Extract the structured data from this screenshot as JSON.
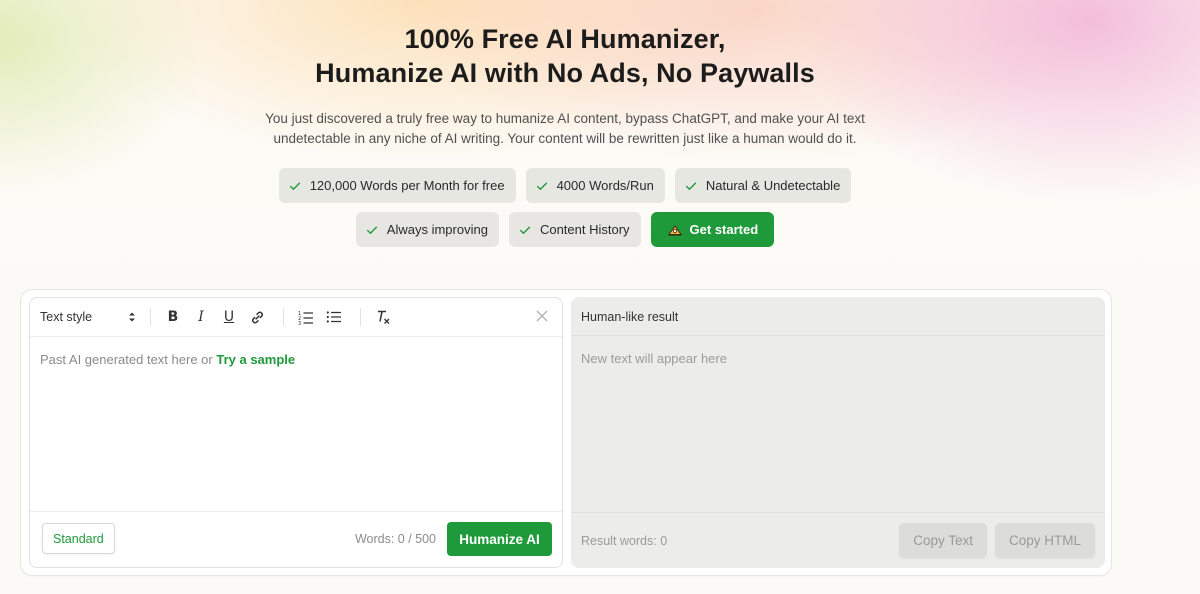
{
  "hero": {
    "title_line1": "100% Free AI Humanizer,",
    "title_line2": "Humanize AI with No Ads, No Paywalls",
    "desc_line1": "You just discovered a truly free way to humanize AI content, bypass ChatGPT, and make your AI text",
    "desc_line2": "undetectable in any niche of AI writing. Your content will be rewritten just like a human would do it."
  },
  "features": {
    "row1": [
      "120,000 Words per Month for free",
      "4000 Words/Run",
      "Natural & Undetectable"
    ],
    "row2": [
      "Always improving",
      "Content History"
    ],
    "cta_label": "Get started"
  },
  "editor": {
    "text_style_label": "Text style",
    "placeholder": "Past AI generated text here or",
    "sample_link": "Try a sample",
    "mode_label": "Standard",
    "word_count": "Words: 0 / 500",
    "humanize_label": "Humanize AI"
  },
  "result": {
    "header": "Human-like result",
    "placeholder": "New text will appear here",
    "word_count": "Result words: 0",
    "copy_text_label": "Copy Text",
    "copy_html_label": "Copy HTML"
  },
  "colors": {
    "accent": "#1f9a3a",
    "pill_bg": "#dcdcd7",
    "result_bg": "#ececeb"
  }
}
